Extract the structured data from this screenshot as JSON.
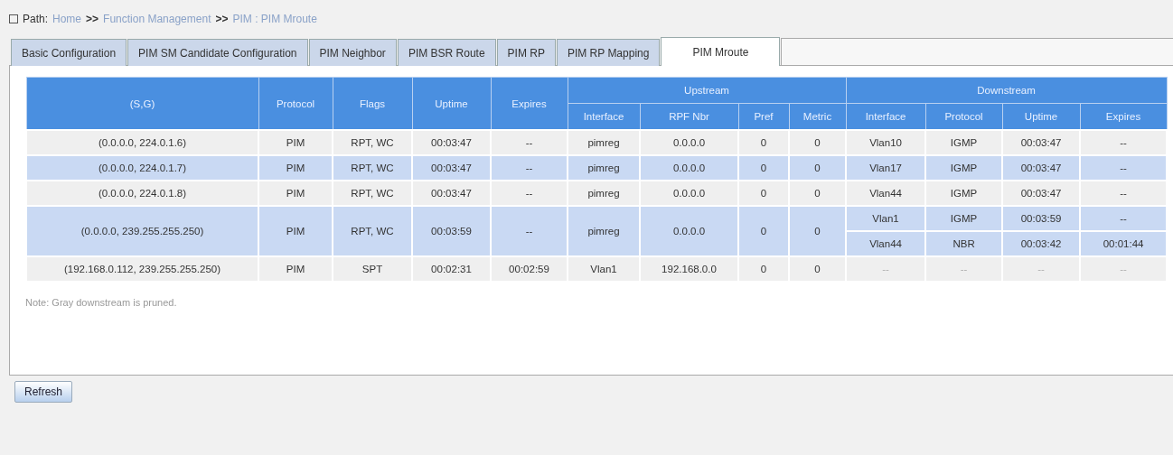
{
  "path": {
    "label": "Path:",
    "separator": ">>",
    "items": [
      "Home",
      "Function Management",
      "PIM : PIM Mroute"
    ]
  },
  "tabs": [
    {
      "label": "Basic Configuration",
      "selected": false
    },
    {
      "label": "PIM SM Candidate Configuration",
      "selected": false
    },
    {
      "label": "PIM Neighbor",
      "selected": false
    },
    {
      "label": "PIM BSR Route",
      "selected": false
    },
    {
      "label": "PIM RP",
      "selected": false
    },
    {
      "label": "PIM RP Mapping",
      "selected": false
    },
    {
      "label": "PIM Mroute",
      "selected": true
    }
  ],
  "table": {
    "columns": [
      "(S,G)",
      "Protocol",
      "Flags",
      "Uptime",
      "Expires"
    ],
    "upstream": {
      "title": "Upstream",
      "columns": [
        "Interface",
        "RPF Nbr",
        "Pref",
        "Metric"
      ]
    },
    "downstream": {
      "title": "Downstream",
      "columns": [
        "Interface",
        "Protocol",
        "Uptime",
        "Expires"
      ]
    },
    "rows": [
      {
        "sg": "(0.0.0.0, 224.0.1.6)",
        "protocol": "PIM",
        "flags": "RPT, WC",
        "uptime": "00:03:47",
        "expires": "--",
        "upstream": [
          "pimreg",
          "0.0.0.0",
          "0",
          "0"
        ],
        "downstream": [
          {
            "cells": [
              "Vlan10",
              "IGMP",
              "00:03:47",
              "--"
            ],
            "pruned": false
          }
        ]
      },
      {
        "sg": "(0.0.0.0, 224.0.1.7)",
        "protocol": "PIM",
        "flags": "RPT, WC",
        "uptime": "00:03:47",
        "expires": "--",
        "upstream": [
          "pimreg",
          "0.0.0.0",
          "0",
          "0"
        ],
        "downstream": [
          {
            "cells": [
              "Vlan17",
              "IGMP",
              "00:03:47",
              "--"
            ],
            "pruned": false
          }
        ]
      },
      {
        "sg": "(0.0.0.0, 224.0.1.8)",
        "protocol": "PIM",
        "flags": "RPT, WC",
        "uptime": "00:03:47",
        "expires": "--",
        "upstream": [
          "pimreg",
          "0.0.0.0",
          "0",
          "0"
        ],
        "downstream": [
          {
            "cells": [
              "Vlan44",
              "IGMP",
              "00:03:47",
              "--"
            ],
            "pruned": false
          }
        ]
      },
      {
        "sg": "(0.0.0.0, 239.255.255.250)",
        "protocol": "PIM",
        "flags": "RPT, WC",
        "uptime": "00:03:59",
        "expires": "--",
        "upstream": [
          "pimreg",
          "0.0.0.0",
          "0",
          "0"
        ],
        "downstream": [
          {
            "cells": [
              "Vlan1",
              "IGMP",
              "00:03:59",
              "--"
            ],
            "pruned": false
          },
          {
            "cells": [
              "Vlan44",
              "NBR",
              "00:03:42",
              "00:01:44"
            ],
            "pruned": false
          }
        ]
      },
      {
        "sg": "(192.168.0.112, 239.255.255.250)",
        "protocol": "PIM",
        "flags": "SPT",
        "uptime": "00:02:31",
        "expires": "00:02:59",
        "upstream": [
          "Vlan1",
          "192.168.0.0",
          "0",
          "0"
        ],
        "downstream": [
          {
            "cells": [
              "--",
              "--",
              "--",
              "--"
            ],
            "pruned": true
          }
        ]
      }
    ]
  },
  "note": "Note: Gray downstream is pruned.",
  "buttons": [
    "Refresh"
  ]
}
